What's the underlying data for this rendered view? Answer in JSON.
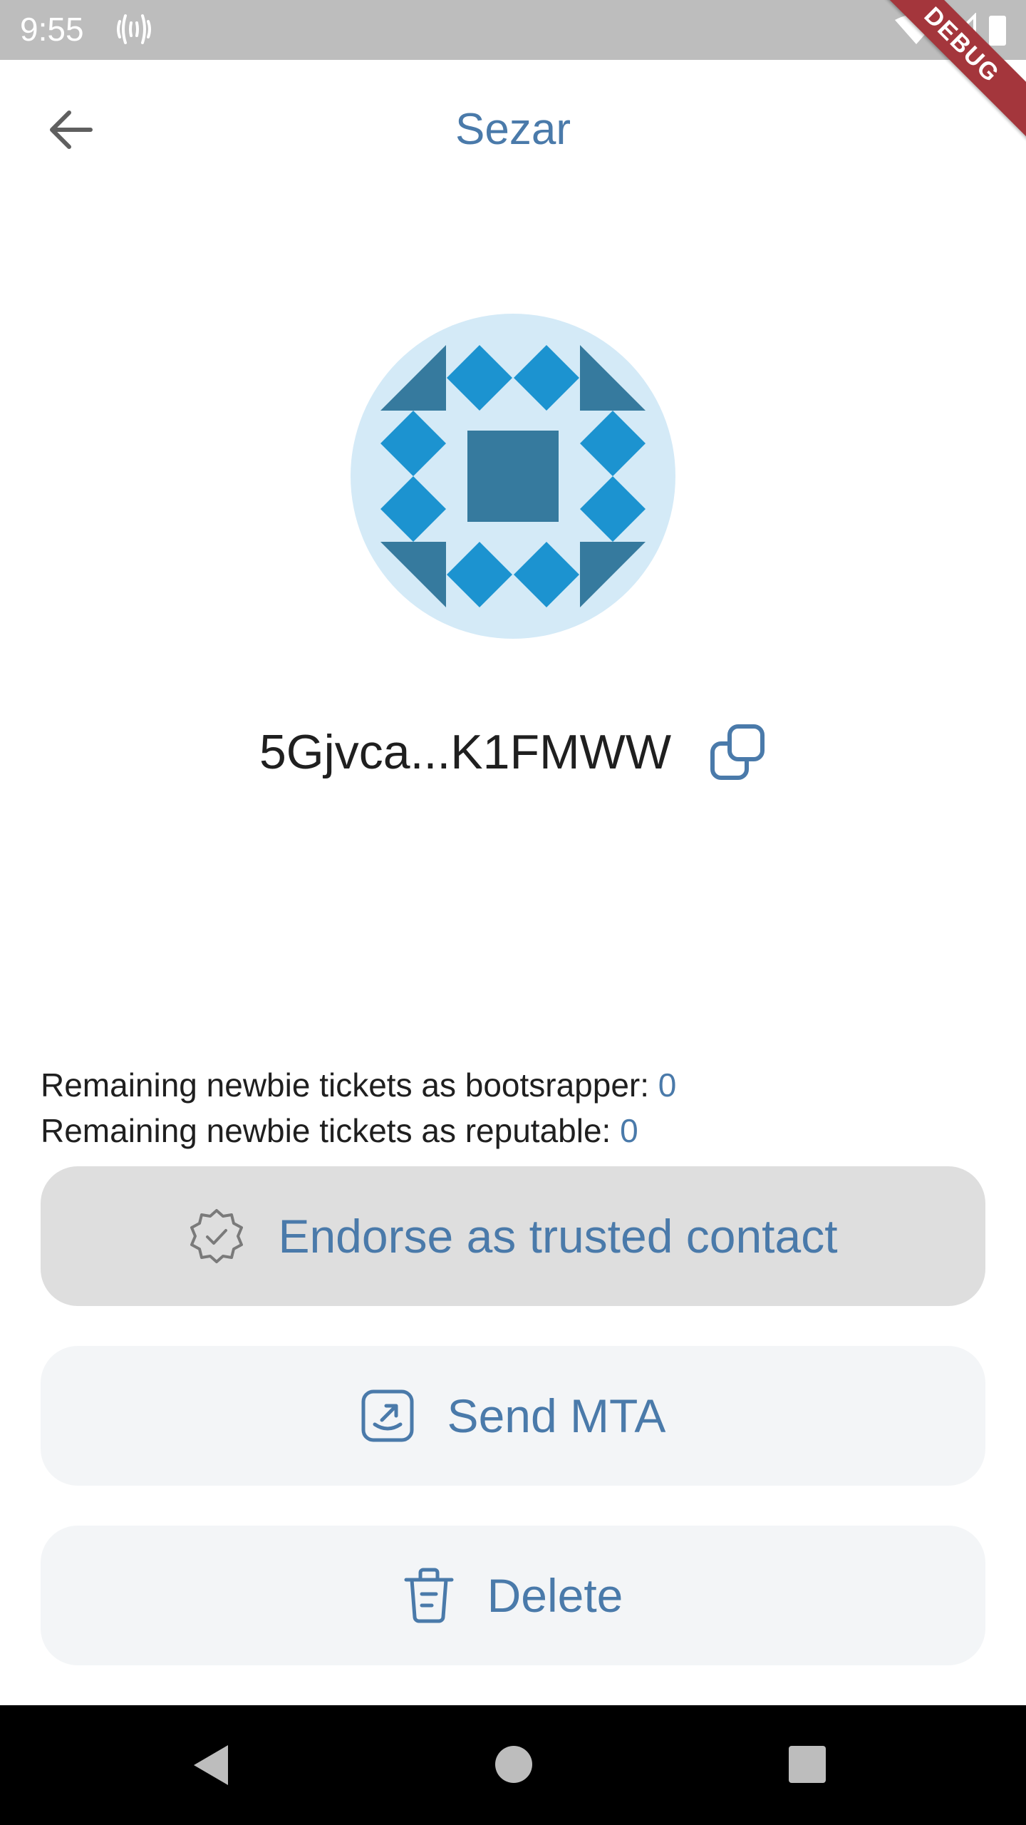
{
  "status_bar": {
    "time": "9:55",
    "debug_label": "DEBUG"
  },
  "app_bar": {
    "title": "Sezar"
  },
  "account": {
    "address": "5Gjvca...K1FMWW"
  },
  "tickets": {
    "bootstrapper_label": "Remaining newbie tickets as bootsrapper:",
    "bootstrapper_value": "0",
    "reputable_label": "Remaining newbie tickets as reputable:",
    "reputable_value": "0"
  },
  "actions": {
    "endorse_label": "Endorse as trusted contact",
    "send_label": "Send MTA",
    "delete_label": "Delete"
  },
  "colors": {
    "accent": "#4a7aaa",
    "identicon_bg": "#d4eaf7",
    "identicon_light": "#1c93d0",
    "identicon_dark": "#367a9e"
  }
}
